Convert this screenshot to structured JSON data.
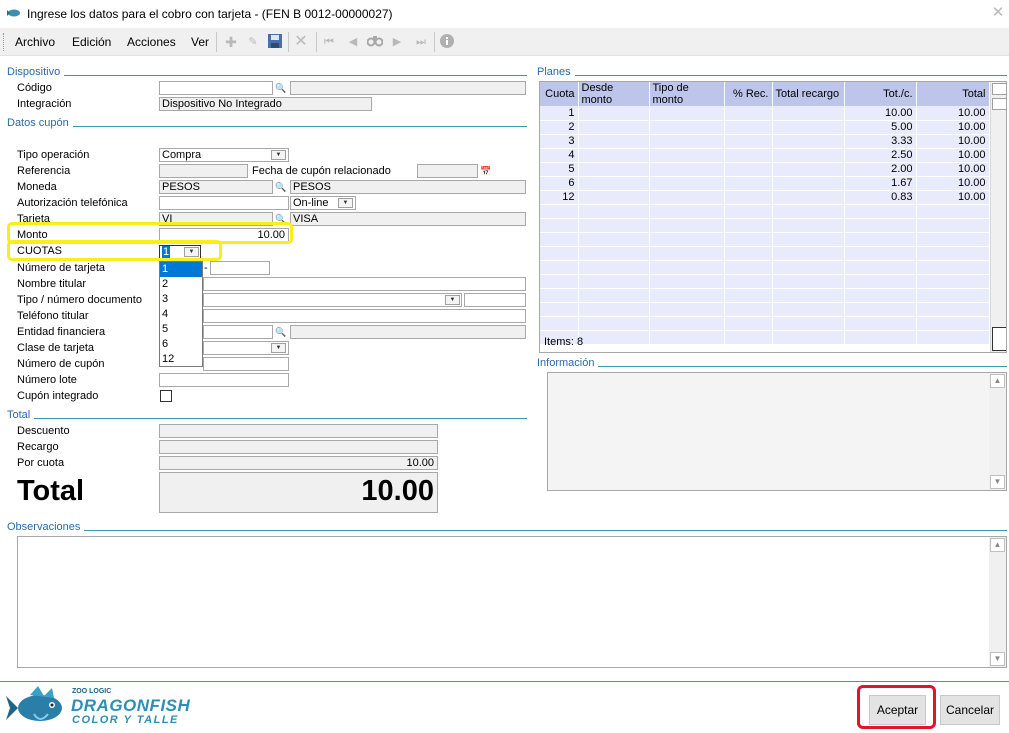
{
  "window": {
    "title": "Ingrese los datos para el cobro con tarjeta - (FEN B 0012-00000027)"
  },
  "menu": [
    "Archivo",
    "Edición",
    "Acciones",
    "Ver"
  ],
  "sections": {
    "dispositivo": "Dispositivo",
    "datos_cupon": "Datos cupón",
    "total": "Total",
    "planes": "Planes",
    "informacion": "Información",
    "observaciones": "Observaciones"
  },
  "dispositivo": {
    "codigo_label": "Código",
    "codigo_value": "",
    "integracion_label": "Integración",
    "integracion_value": "Dispositivo No Integrado"
  },
  "cupon": {
    "tipo_operacion_label": "Tipo operación",
    "tipo_operacion_value": "Compra",
    "referencia_label": "Referencia",
    "fecha_cupon_label": "Fecha de cupón relacionado",
    "moneda_label": "Moneda",
    "moneda_code": "PESOS",
    "moneda_desc": "PESOS",
    "autorizacion_label": "Autorización telefónica",
    "autorizacion_mode": "On-line",
    "tarjeta_label": "Tarjeta",
    "tarjeta_code": "VI",
    "tarjeta_desc": "VISA",
    "monto_label": "Monto",
    "monto_value": "10.00",
    "cuotas_label": "CUOTAS",
    "cuotas_value": "1",
    "cuotas_options": [
      "1",
      "2",
      "3",
      "4",
      "5",
      "6",
      "12"
    ],
    "numero_tarjeta_label": "Número de tarjeta",
    "numero_tarjeta_sep": "-",
    "nombre_titular_label": "Nombre titular",
    "tipo_documento_label": "Tipo / número documento",
    "telefono_label": "Teléfono titular",
    "entidad_label": "Entidad financiera",
    "clase_label": "Clase de tarjeta",
    "numero_cupon_label": "Número de cupón",
    "numero_lote_label": "Número lote",
    "cupon_integrado_label": "Cupón integrado"
  },
  "totals": {
    "descuento_label": "Descuento",
    "recargo_label": "Recargo",
    "por_cuota_label": "Por cuota",
    "por_cuota_value": "10.00",
    "total_label": "Total",
    "total_value": "10.00"
  },
  "planes": {
    "columns": [
      "Cuota",
      "Desde monto",
      "Tipo de monto",
      "% Rec.",
      "Total recargo",
      "Tot./c.",
      "Total"
    ],
    "rows": [
      [
        "1",
        "",
        "",
        "",
        "",
        "10.00",
        "10.00"
      ],
      [
        "2",
        "",
        "",
        "",
        "",
        "5.00",
        "10.00"
      ],
      [
        "3",
        "",
        "",
        "",
        "",
        "3.33",
        "10.00"
      ],
      [
        "4",
        "",
        "",
        "",
        "",
        "2.50",
        "10.00"
      ],
      [
        "5",
        "",
        "",
        "",
        "",
        "2.00",
        "10.00"
      ],
      [
        "6",
        "",
        "",
        "",
        "",
        "1.67",
        "10.00"
      ],
      [
        "12",
        "",
        "",
        "",
        "",
        "0.83",
        "10.00"
      ]
    ],
    "items_label": "Items: 8"
  },
  "logo": {
    "brand": "ZOO LOGIC",
    "name": "DRAGONFISH",
    "tagline": "COLOR Y TALLE"
  },
  "buttons": {
    "aceptar": "Aceptar",
    "cancelar": "Cancelar"
  },
  "colors": {
    "accent": "#3a9aa8",
    "section_text": "#2a6aa8",
    "grid_header": "#bdc5ea",
    "grid_row": "#e7ebfb",
    "highlight_yellow": "#f7ef1b",
    "highlight_red": "#e0142a",
    "selection": "#0078d7"
  }
}
